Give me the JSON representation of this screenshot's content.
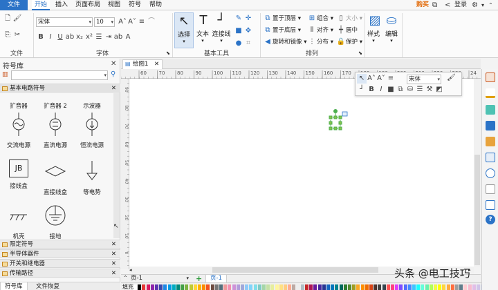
{
  "menu": {
    "file": "文件",
    "items": [
      "开始",
      "插入",
      "页面布局",
      "视图",
      "符号",
      "帮助"
    ],
    "active_index": 0,
    "buy": "购买",
    "login": "登录"
  },
  "ribbon": {
    "groups": {
      "file": "文件",
      "font": "字体",
      "basic_tools": "基本工具",
      "arrange": "排列"
    },
    "font_name": "宋体",
    "font_size": "10",
    "select_label": "选择",
    "text_label": "文本",
    "connector_label": "连接线",
    "bring_front": "置于顶层",
    "send_back": "置于底层",
    "rotate_mirror": "旋转和镜像",
    "group": "组合",
    "align": "对齐",
    "distribute": "分布",
    "size": "大小",
    "center": "居中",
    "protect": "保护",
    "style": "样式",
    "edit": "编辑"
  },
  "library": {
    "title": "符号库",
    "section_title": "基本电路符号",
    "shapes": [
      {
        "label": "扩音器",
        "sub": "交流电源"
      },
      {
        "label": "扩音器 2",
        "sub": "直流电源"
      },
      {
        "label": "示波器",
        "sub": "恒流电源"
      }
    ],
    "shapes_row2": [
      {
        "label": "JB",
        "sub": "接线盒"
      },
      {
        "label": "",
        "sub": "直接线盒"
      },
      {
        "label": "",
        "sub": "等电势"
      }
    ],
    "shapes_row3": [
      {
        "sub": "机壳"
      },
      {
        "sub": "接地"
      }
    ],
    "sections": [
      "限定符号",
      "半导体器件",
      "开关和继电器",
      "传输路径"
    ],
    "bottom_tabs": [
      "符号库",
      "文件恢复"
    ]
  },
  "document": {
    "tab": "绘图1",
    "ruler_top": [
      "60",
      "70",
      "80",
      "90",
      "100",
      "110",
      "120",
      "130",
      "140",
      "150",
      "160",
      "170",
      "180",
      "190",
      "200",
      "210",
      "220",
      "230",
      "24"
    ],
    "ruler_left": [
      "90",
      "80",
      "70",
      "60",
      "50",
      "40",
      "30",
      "20",
      "10",
      "0",
      "-10",
      "-20"
    ],
    "page_selector": "页-1",
    "page_tab": "页-1",
    "fill_label": "填充"
  },
  "floatbar": {
    "font_name": "宋体"
  },
  "watermark": "头条 @电工技巧",
  "colors": {
    "accent": "#2b73c7",
    "buy": "#e26b0a",
    "shape_green": "#4caf50"
  }
}
